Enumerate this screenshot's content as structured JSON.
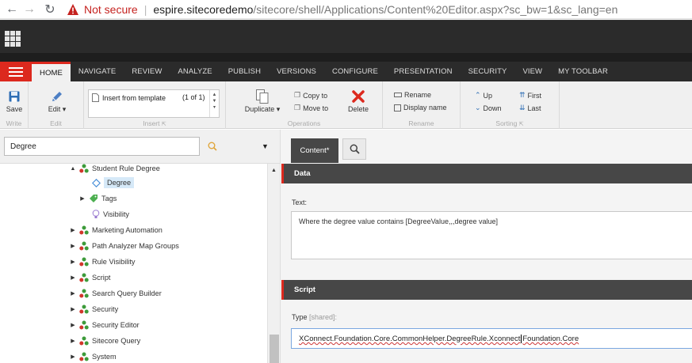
{
  "browser": {
    "security_label": "Not secure",
    "url_host": "espire.sitecoredemo",
    "url_path": "/sitecore/shell/Applications/Content%20Editor.aspx?sc_bw=1&sc_lang=en",
    "warning_color": "#c5221f"
  },
  "ribbon": {
    "tabs": [
      "HOME",
      "NAVIGATE",
      "REVIEW",
      "ANALYZE",
      "PUBLISH",
      "VERSIONS",
      "CONFIGURE",
      "PRESENTATION",
      "SECURITY",
      "VIEW",
      "MY TOOLBAR"
    ],
    "active_tab": "HOME",
    "accent_color": "#dc291e",
    "groups": {
      "write": {
        "label": "Write",
        "save": "Save"
      },
      "edit": {
        "label": "Edit",
        "edit": "Edit"
      },
      "insert": {
        "label": "Insert",
        "template": "Insert from template",
        "page": "(1 of 1)"
      },
      "operations": {
        "label": "Operations",
        "duplicate": "Duplicate",
        "copy_to": "Copy to",
        "move_to": "Move to",
        "delete": "Delete"
      },
      "rename": {
        "label": "Rename",
        "rename": "Rename",
        "display_name": "Display name"
      },
      "sorting": {
        "label": "Sorting",
        "up": "Up",
        "down": "Down",
        "first": "First",
        "last": "Last"
      }
    }
  },
  "tree": {
    "search_value": "Degree",
    "items": [
      {
        "label": "Student Rule Degree",
        "arrow": "▲",
        "icon": "rule-icon"
      },
      {
        "label": "Degree",
        "arrow": "",
        "icon": "diamond-icon",
        "selected": true
      },
      {
        "label": "Tags",
        "arrow": "▶",
        "icon": "tag-icon"
      },
      {
        "label": "Visibility",
        "arrow": "",
        "icon": "bulb-icon"
      },
      {
        "label": "Marketing Automation",
        "arrow": "▶",
        "icon": "rule-icon"
      },
      {
        "label": "Path Analyzer Map Groups",
        "arrow": "▶",
        "icon": "rule-icon"
      },
      {
        "label": "Rule Visibility",
        "arrow": "▶",
        "icon": "rule-icon"
      },
      {
        "label": "Script",
        "arrow": "▶",
        "icon": "rule-icon"
      },
      {
        "label": "Search Query Builder",
        "arrow": "▶",
        "icon": "rule-icon"
      },
      {
        "label": "Security",
        "arrow": "▶",
        "icon": "rule-icon"
      },
      {
        "label": "Security Editor",
        "arrow": "▶",
        "icon": "rule-icon"
      },
      {
        "label": "Sitecore Query",
        "arrow": "▶",
        "icon": "rule-icon"
      },
      {
        "label": "System",
        "arrow": "▶",
        "icon": "rule-icon"
      }
    ]
  },
  "editor": {
    "tab_label": "Content*",
    "data_section": "Data",
    "text_label": "Text:",
    "text_value": "Where the degree value contains [DegreeValue,,,degree value]",
    "script_section": "Script",
    "type_label": "Type",
    "type_shared": "[shared]:",
    "type_value_a": "XConnect.Foundation.Core.CommonHelper.DegreeRule.Xconnect",
    "type_value_b": "Foundation.Core"
  }
}
